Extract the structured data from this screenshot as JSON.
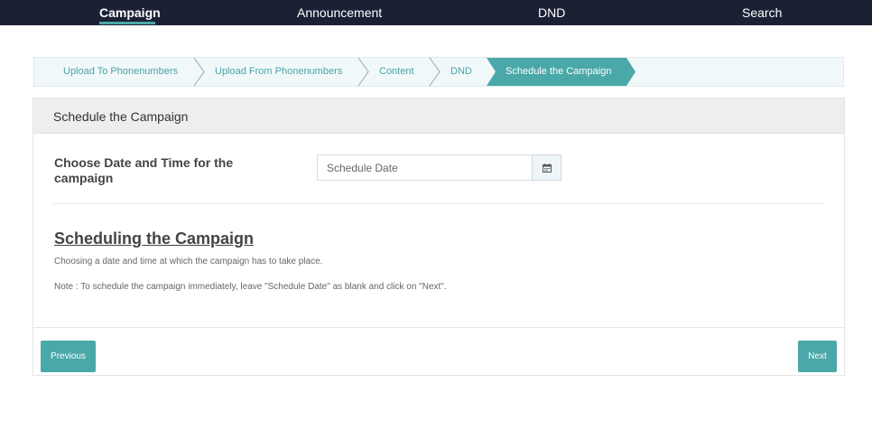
{
  "nav": {
    "items": [
      {
        "label": "Campaign",
        "active": true
      },
      {
        "label": "Announcement",
        "active": false
      },
      {
        "label": "DND",
        "active": false
      },
      {
        "label": "Search",
        "active": false
      }
    ]
  },
  "steps": [
    {
      "label": "Upload To Phonenumbers"
    },
    {
      "label": "Upload From Phonenumbers"
    },
    {
      "label": "Content"
    },
    {
      "label": "DND"
    },
    {
      "label": "Schedule the Campaign",
      "active": true
    }
  ],
  "panel": {
    "title": "Schedule the Campaign",
    "field_label": "Choose Date and Time for the campaign",
    "date_placeholder": "Schedule Date",
    "date_value": "",
    "calendar_icon": "calendar-icon",
    "help_title": "Scheduling the Campaign",
    "help_description": "Choosing a date and time at which the campaign has to take place.",
    "help_note": "Note : To schedule the campaign immediately, leave \"Schedule Date\" as blank and click on \"Next\"."
  },
  "footer": {
    "previous_label": "Previous",
    "next_label": "Next"
  },
  "colors": {
    "nav_bg": "#1b2135",
    "accent": "#4aa8a8",
    "steps_bg": "#f1f8f9"
  }
}
